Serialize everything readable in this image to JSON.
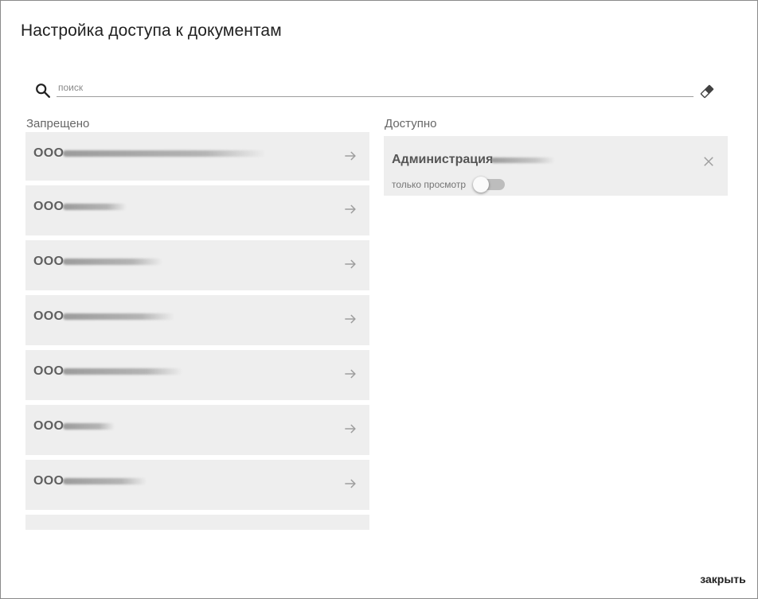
{
  "dialog": {
    "title": "Настройка доступа к документам",
    "close_label": "закрыть"
  },
  "search": {
    "placeholder": "поиск",
    "value": ""
  },
  "columns": {
    "forbidden_label": "Запрещено",
    "allowed_label": "Доступно"
  },
  "forbidden_items": [
    {
      "name": "ООО"
    },
    {
      "name": "ООО"
    },
    {
      "name": "ООО"
    },
    {
      "name": "ООО"
    },
    {
      "name": "ООО"
    },
    {
      "name": "ООО"
    },
    {
      "name": "ООО"
    },
    {
      "name": ""
    }
  ],
  "allowed_items": [
    {
      "name": "Администрация",
      "view_only_label": "только просмотр",
      "view_only": false
    }
  ],
  "colors": {
    "item_background": "#eeeeee",
    "text": "#212121",
    "muted_text": "#666666",
    "toggle_track": "#bdbdbd"
  },
  "icons": {
    "search": "search-icon",
    "eraser": "eraser-icon",
    "arrow": "arrow-right-icon",
    "close": "close-icon"
  }
}
